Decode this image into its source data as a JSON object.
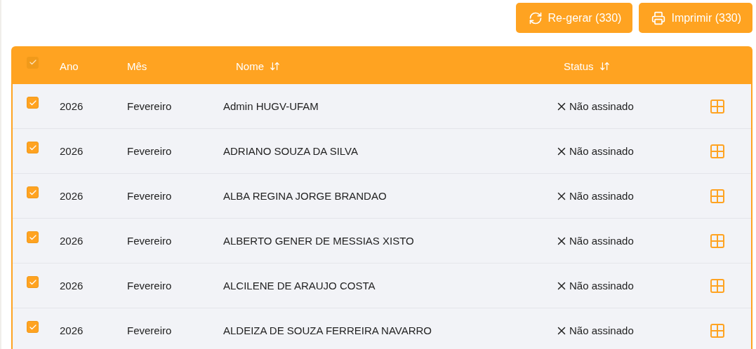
{
  "toolbar": {
    "buttons": [
      {
        "kind": "regenerate",
        "label": "Re-gerar (330)"
      },
      {
        "kind": "print",
        "label": "Imprimir (330)"
      }
    ]
  },
  "table": {
    "select_all": {
      "checked": true
    },
    "columns": [
      {
        "label": "Ano",
        "sortable": false
      },
      {
        "label": "Mês",
        "sortable": false
      },
      {
        "label": "Nome",
        "sortable": true
      },
      {
        "label": "Status",
        "sortable": true
      }
    ],
    "rows": [
      {
        "checked": true,
        "year": "2026",
        "month": "Fevereiro",
        "name": "Admin HUGV-UFAM",
        "status": "Não assinado",
        "signed": false
      },
      {
        "checked": true,
        "year": "2026",
        "month": "Fevereiro",
        "name": "ADRIANO SOUZA DA SILVA",
        "status": "Não assinado",
        "signed": false
      },
      {
        "checked": true,
        "year": "2026",
        "month": "Fevereiro",
        "name": "ALBA REGINA JORGE BRANDAO",
        "status": "Não assinado",
        "signed": false
      },
      {
        "checked": true,
        "year": "2026",
        "month": "Fevereiro",
        "name": "ALBERTO GENER DE MESSIAS XISTO",
        "status": "Não assinado",
        "signed": false
      },
      {
        "checked": true,
        "year": "2026",
        "month": "Fevereiro",
        "name": "ALCILENE DE ARAUJO COSTA",
        "status": "Não assinado",
        "signed": false
      },
      {
        "checked": true,
        "year": "2026",
        "month": "Fevereiro",
        "name": "ALDEIZA DE SOUZA FERREIRA NAVARRO",
        "status": "Não assinado",
        "signed": false
      }
    ]
  }
}
